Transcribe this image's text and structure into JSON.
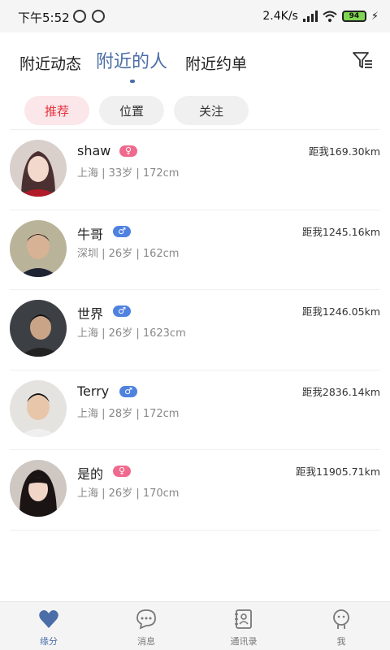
{
  "status_bar": {
    "time": "下午5:52",
    "network_speed": "2.4K/s",
    "battery": "94"
  },
  "header": {
    "tabs": [
      {
        "label": "附近动态",
        "active": false
      },
      {
        "label": "附近的人",
        "active": true
      },
      {
        "label": "附近约单",
        "active": false
      }
    ],
    "filter_icon": "filter-icon",
    "accent_color": "#4b6ea8"
  },
  "chips": [
    {
      "label": "推荐",
      "active": true
    },
    {
      "label": "位置",
      "active": false
    },
    {
      "label": "关注",
      "active": false
    }
  ],
  "people": [
    {
      "name": "shaw",
      "gender": "female",
      "badge": "♀",
      "meta": "上海 | 33岁 | 172cm",
      "distance": "距我169.30km"
    },
    {
      "name": "牛哥",
      "gender": "male",
      "badge": "♂",
      "meta": "深圳 | 26岁 | 162cm",
      "distance": "距我1245.16km"
    },
    {
      "name": "世界",
      "gender": "male",
      "badge": "♂",
      "meta": "上海 | 26岁 | 1623cm",
      "distance": "距我1246.05km"
    },
    {
      "name": "Terry",
      "gender": "male",
      "badge": "♂",
      "meta": "上海 | 28岁 | 172cm",
      "distance": "距我2836.14km"
    },
    {
      "name": "是的",
      "gender": "female",
      "badge": "♀",
      "meta": "上海 | 26岁 | 170cm",
      "distance": "距我11905.71km"
    }
  ],
  "bottom_nav": [
    {
      "label": "缘分",
      "icon": "heart-icon",
      "active": true
    },
    {
      "label": "消息",
      "icon": "chat-icon",
      "active": false
    },
    {
      "label": "通讯录",
      "icon": "contacts-icon",
      "active": false
    },
    {
      "label": "我",
      "icon": "profile-icon",
      "active": false
    }
  ]
}
